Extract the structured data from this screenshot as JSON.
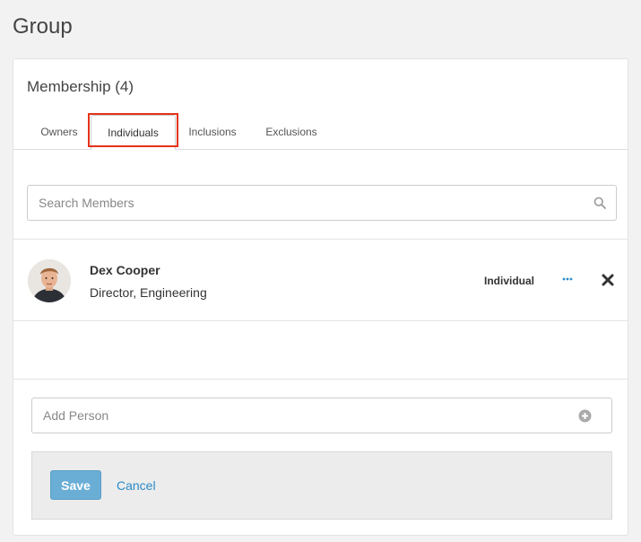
{
  "page": {
    "title": "Group"
  },
  "membership": {
    "title": "Membership (4)",
    "tabs": [
      {
        "label": "Owners",
        "active": false
      },
      {
        "label": "Individuals",
        "active": true
      },
      {
        "label": "Inclusions",
        "active": false
      },
      {
        "label": "Exclusions",
        "active": false
      }
    ],
    "search": {
      "placeholder": "Search Members",
      "value": ""
    },
    "members": [
      {
        "name": "Dex Cooper",
        "title": "Director, Engineering",
        "type": "Individual"
      }
    ],
    "add_person": {
      "placeholder": "Add Person",
      "value": ""
    },
    "actions": {
      "save_label": "Save",
      "cancel_label": "Cancel"
    }
  },
  "icons": {
    "search": "search-icon",
    "more": "more-icon",
    "remove": "close-icon",
    "add": "plus-circle-icon"
  },
  "colors": {
    "accent": "#2a8bc9",
    "save_button": "#6aaed6",
    "tab_highlight": "#e5321a"
  }
}
